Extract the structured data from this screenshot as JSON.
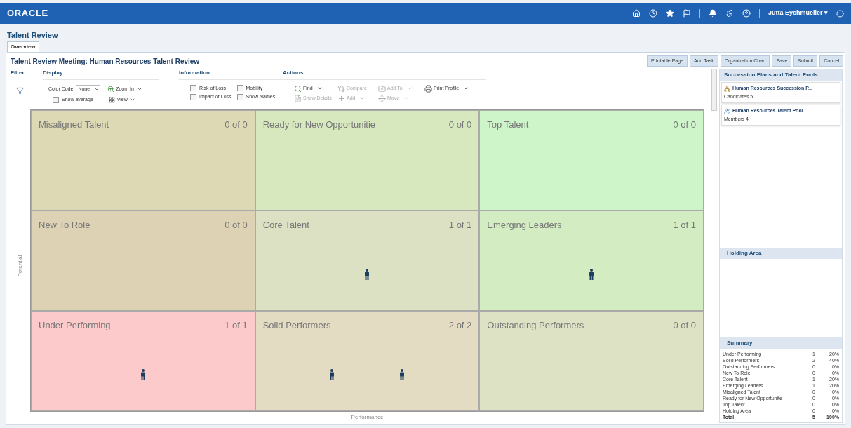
{
  "topbar": {
    "logo": "ORACLE",
    "user": "Jutta Eychmueller ▾"
  },
  "page": {
    "title": "Talent Review",
    "tabs": [
      {
        "label": "Overview",
        "selected": true
      }
    ],
    "heading": "Talent Review Meeting: Human Resources Talent Review"
  },
  "buttons": [
    "Printable Page",
    "Add Task",
    "Organization Chart",
    "Save",
    "Submit",
    "Cancel"
  ],
  "toolbar": {
    "filter": {
      "title": "Filter"
    },
    "display": {
      "title": "Display",
      "color_code_label": "Color Code",
      "color_code_value": "None",
      "zoom": "Zoom In",
      "view": "View",
      "show_average": {
        "label": "Show average",
        "checked": false
      }
    },
    "information": {
      "title": "Information",
      "options": [
        {
          "label": "Risk of Loss",
          "checked": false
        },
        {
          "label": "Mobility",
          "checked": false
        },
        {
          "label": "Impact of Loss",
          "checked": false
        },
        {
          "label": "Show Names",
          "checked": false
        }
      ]
    },
    "actions": {
      "title": "Actions",
      "items": [
        {
          "label": "Find",
          "kind": "find",
          "dropdown": true,
          "disabled": false
        },
        {
          "label": "Compare",
          "kind": "compare",
          "dropdown": false,
          "disabled": true
        },
        {
          "label": "Add To",
          "kind": "addto",
          "dropdown": true,
          "disabled": true
        },
        {
          "label": "Print Profile",
          "kind": "print",
          "dropdown": true,
          "disabled": false
        },
        {
          "label": "Show Details",
          "kind": "details",
          "dropdown": false,
          "disabled": true
        },
        {
          "label": "Add",
          "kind": "add",
          "dropdown": true,
          "disabled": true
        },
        {
          "label": "Move",
          "kind": "move",
          "dropdown": true,
          "disabled": true
        }
      ]
    }
  },
  "grid": {
    "y_label": "Potential",
    "x_label": "Performance",
    "cells": [
      {
        "name": "Misaligned Talent",
        "count": "0 of 0",
        "color": "#dcd9b4"
      },
      {
        "name": "Ready for New Opportunitie",
        "count": "0 of 0",
        "color": "#d7e8bf"
      },
      {
        "name": "Top Talent",
        "count": "0 of 0",
        "color": "#cdf5c9"
      },
      {
        "name": "New To Role",
        "count": "0 of 0",
        "color": "#ddd2b3"
      },
      {
        "name": "Core Talent",
        "count": "1 of 1",
        "color": "#dde1c3",
        "people": [
          {
            "kind": "person"
          }
        ]
      },
      {
        "name": "Emerging Leaders",
        "count": "1 of 1",
        "color": "#d3ecc2",
        "people": [
          {
            "kind": "person"
          }
        ]
      },
      {
        "name": "Under Performing",
        "count": "1 of 1",
        "color": "#fccaca",
        "people": [
          {
            "kind": "person"
          }
        ]
      },
      {
        "name": "Solid Performers",
        "count": "2 of 2",
        "color": "#e4dbc3",
        "people": [
          {
            "kind": "person"
          },
          {
            "kind": "person"
          }
        ]
      },
      {
        "name": "Outstanding Performers",
        "count": "0 of 0",
        "color": "#dee2c4"
      }
    ]
  },
  "side": {
    "plans_title": "Succession Plans and Talent Pools",
    "plans": [
      {
        "kind": "plan",
        "name": "Human Resources Succession P...",
        "detail": "Candidates 5"
      },
      {
        "kind": "pool",
        "name": "Human Resources Talent Pool",
        "detail": "Members 4"
      }
    ],
    "holding_title": "Holding Area",
    "summary_title": "Summary",
    "summary": [
      {
        "label": "Under Performing",
        "count": "1",
        "pct": "20%"
      },
      {
        "label": "Solid Performers",
        "count": "2",
        "pct": "40%"
      },
      {
        "label": "Outstanding Performers",
        "count": "0",
        "pct": "0%"
      },
      {
        "label": "New To Role",
        "count": "0",
        "pct": "0%"
      },
      {
        "label": "Core Talent",
        "count": "1",
        "pct": "20%"
      },
      {
        "label": "Emerging Leaders",
        "count": "1",
        "pct": "20%"
      },
      {
        "label": "Misaligned Talent",
        "count": "0",
        "pct": "0%"
      },
      {
        "label": "Ready for New Opportunite",
        "count": "0",
        "pct": "0%"
      },
      {
        "label": "Top Talent",
        "count": "0",
        "pct": "0%"
      },
      {
        "label": "Holding Area",
        "count": "0",
        "pct": "0%"
      }
    ],
    "total": {
      "label": "Total",
      "count": "5",
      "pct": "100%"
    }
  }
}
